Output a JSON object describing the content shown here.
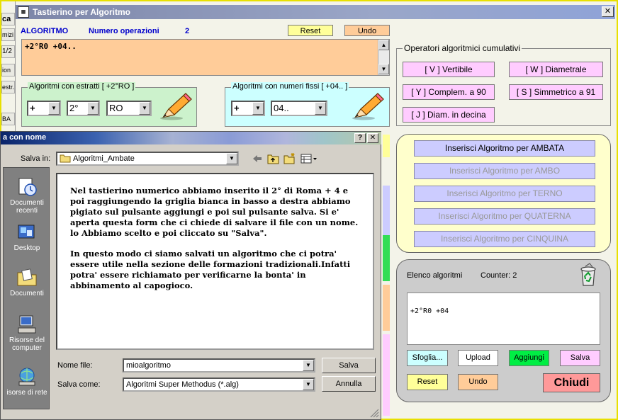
{
  "window": {
    "title": "Tastierino per Algoritmo",
    "close": "✕",
    "app_icon": "▦",
    "background_tabs": [
      "ca",
      "mizi",
      "1/2",
      "ion",
      "estr.",
      "BA"
    ]
  },
  "header": {
    "algoritmo_label": "ALGORITMO",
    "num_operazioni_label": "Numero operazioni",
    "num_operazioni_value": "2",
    "reset_label": "Reset",
    "undo_label": "Undo"
  },
  "algo_text": "+2°R0 +04..",
  "estratti": {
    "label": "Algoritmi con estratti  [ +2°RO ]",
    "sign": "+",
    "position": "2°",
    "wheel": "RO"
  },
  "fissi": {
    "label": "Algoritmi con numeri fissi  [ +04.. ]",
    "sign": "+",
    "number": "04.."
  },
  "operatori": {
    "label": "Operatori algoritmici cumulativi",
    "buttons": [
      "[ V ] Vertibile",
      "[ W ] Diametrale",
      "[ Y ] Complem. a 90",
      "[ S ] Simmetrico  a 91",
      "[ J ] Diam. in decina"
    ]
  },
  "inserisci": {
    "buttons": [
      "Inserisci Algoritmo per AMBATA",
      "Inserisci Algoritmo per AMBO",
      "Inserisci Algoritmo per TERNO",
      "Inserisci Algoritmo per QUATERNA",
      "Inserisci Algoritmo per CINQUINA"
    ]
  },
  "elenco": {
    "title": "Elenco algoritmi",
    "counter": "Counter: 2",
    "items": [
      "+2°R0 +04"
    ],
    "sfoglia": "Sfoglia...",
    "upload": "Upload",
    "aggiungi": "Aggiungi",
    "salva": "Salva",
    "reset": "Reset",
    "undo": "Undo",
    "chiudi": "Chiudi"
  },
  "dialog": {
    "title": "a con nome",
    "help": "?",
    "close": "✕",
    "save_in_label": "Salva in:",
    "save_in_value": "Algoritmi_Ambate",
    "places": [
      "Documenti recenti",
      "Desktop",
      "Documenti",
      "Risorse del computer",
      "isorse di rete"
    ],
    "message_p1": "Nel tastierino numerico abbiamo inserito il 2° di Roma + 4 e poi raggiungendo la griglia bianca in basso a destra abbiamo pigiato sul pulsante aggiungi e poi sul pulsante salva. Si e' aperta questa form che ci chiede di salvare il file con un nome. lo Abbiamo scelto e poi cliccato su \"Salva\".",
    "message_p2": "In questo modo ci siamo salvati un algoritmo che ci potra' essere utile nella sezione delle formazioni tradizionali.Infatti potra' essere richiamato per verificarne la bonta' in abbinamento al capogioco.",
    "filename_label": "Nome file:",
    "filename_value": "mioalgoritmo",
    "filetype_label": "Salva come:",
    "filetype_value": "Algoritmi Super Methodus (*.alg)",
    "save_button": "Salva",
    "cancel_button": "Annulla"
  },
  "colors": {
    "reset_yellow": "#ffff99",
    "undo_orange": "#ffcc99",
    "operator_pink": "#ffccff",
    "insert_lavender": "#ccccff",
    "aggiungi_green": "#00ee44",
    "chiudi_red": "#ff9999"
  }
}
